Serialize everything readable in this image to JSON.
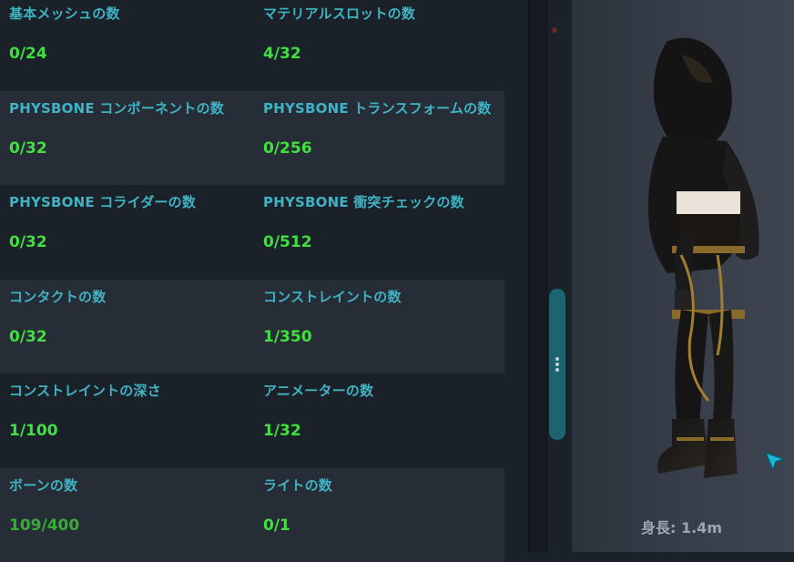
{
  "stats": [
    {
      "row": 0,
      "items": [
        {
          "label": "基本メッシュの数",
          "value": "0/24"
        },
        {
          "label": "マテリアルスロットの数",
          "value": "4/32"
        }
      ]
    },
    {
      "row": 1,
      "items": [
        {
          "label": "PHYSBONE コンポーネントの数",
          "value": "0/32"
        },
        {
          "label": "PHYSBONE トランスフォームの数",
          "value": "0/256"
        }
      ]
    },
    {
      "row": 2,
      "items": [
        {
          "label": "PHYSBONE コライダーの数",
          "value": "0/32"
        },
        {
          "label": "PHYSBONE 衝突チェックの数",
          "value": "0/512"
        }
      ]
    },
    {
      "row": 3,
      "items": [
        {
          "label": "コンタクトの数",
          "value": "0/32"
        },
        {
          "label": "コンストレイントの数",
          "value": "1/350"
        }
      ]
    },
    {
      "row": 4,
      "items": [
        {
          "label": "コンストレイントの深さ",
          "value": "1/100"
        },
        {
          "label": "アニメーターの数",
          "value": "1/32"
        }
      ]
    },
    {
      "row": 5,
      "items": [
        {
          "label": "ボーンの数",
          "value": "109/400"
        },
        {
          "label": "ライトの数",
          "value": "0/1"
        }
      ]
    }
  ],
  "preview": {
    "height_label": "身長: 1.4m",
    "cursor_icon": "pointer-arrow-icon",
    "avatar": "avatar-figure"
  },
  "colors": {
    "label": "#3fb3c4",
    "value": "#3fe040",
    "value_dim": "#3aab37",
    "scroll_thumb": "#1c6470"
  }
}
